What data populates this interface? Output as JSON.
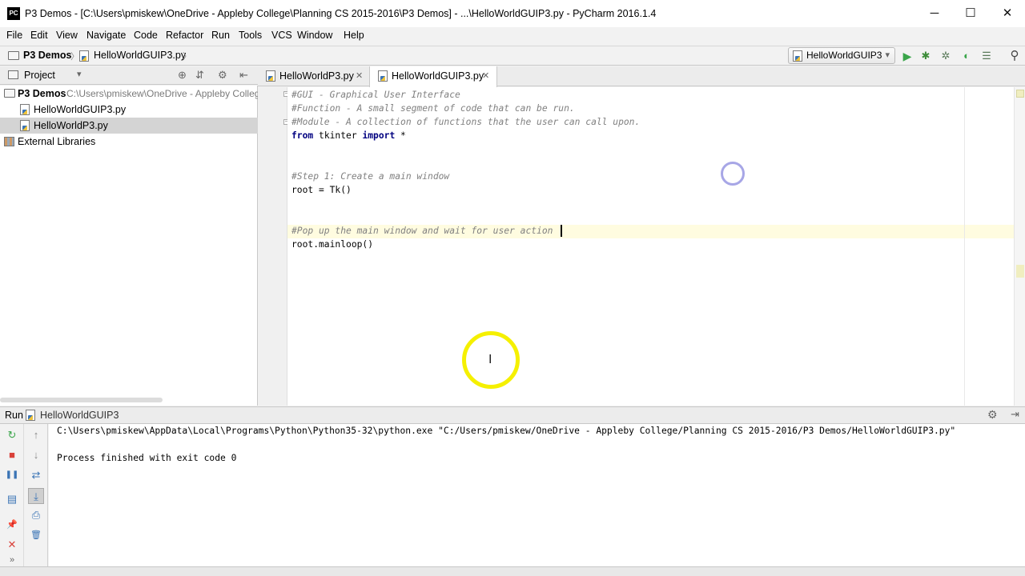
{
  "window": {
    "app_icon": "pycharm-logo",
    "app_icon_text": "PC",
    "title": "P3 Demos - [C:\\Users\\pmiskew\\OneDrive - Appleby College\\Planning CS 2015-2016\\P3 Demos] - ...\\HelloWorldGUIP3.py - PyCharm 2016.1.4",
    "minimize": "─",
    "maximize": "☐",
    "close": "✕"
  },
  "menu": [
    "File",
    "Edit",
    "View",
    "Navigate",
    "Code",
    "Refactor",
    "Run",
    "Tools",
    "VCS",
    "Window",
    "Help"
  ],
  "breadcrumb": {
    "project": "P3 Demos",
    "file": "HelloWorldGUIP3.py",
    "separator": "〉"
  },
  "toolbar": {
    "run_config": "HelloWorldGUIP3",
    "dropdown_icon": "▾",
    "run_icon": "▶",
    "debug_icon": "✱",
    "coverage_icon": "✲",
    "profile_icon": "◐",
    "concurrency_icon": "☰",
    "search_icon": "⚲"
  },
  "project_panel": {
    "label": "Project",
    "dropdown_icon": "▾",
    "tree": [
      {
        "label": "P3 Demos",
        "path": "C:\\Users\\pmiskew\\OneDrive - Appleby College",
        "selected": false
      },
      {
        "label": "HelloWorldGUIP3.py",
        "selected": false
      },
      {
        "label": "HelloWorldP3.py",
        "selected": true
      },
      {
        "label": "External Libraries",
        "selected": false
      }
    ]
  },
  "tabs": [
    {
      "label": "HelloWorldP3.py",
      "active": false,
      "close": "✕"
    },
    {
      "label": "HelloWorldGUIP3.py",
      "active": true,
      "close": "✕"
    }
  ],
  "editor": {
    "lines": [
      {
        "kind": "comment",
        "text": "#GUI - Graphical User Interface"
      },
      {
        "kind": "comment",
        "text": "#Function - A small segment of code that can be run."
      },
      {
        "kind": "comment",
        "text": "#Module - A collection of functions that the user can call upon."
      },
      {
        "kind": "import",
        "kw1": "from",
        "mod": " tkinter ",
        "kw2": "import",
        "rest": " *"
      },
      {
        "kind": "blank",
        "text": ""
      },
      {
        "kind": "blank",
        "text": ""
      },
      {
        "kind": "comment",
        "text": "#Step 1: Create a main window"
      },
      {
        "kind": "code",
        "text": "root = Tk()"
      },
      {
        "kind": "blank",
        "text": ""
      },
      {
        "kind": "blank",
        "text": ""
      },
      {
        "kind": "comment",
        "text": "#Pop up the main window and wait for user action"
      },
      {
        "kind": "code",
        "text": "root.mainloop()"
      }
    ]
  },
  "run_panel": {
    "label": "Run",
    "config": "HelloWorldGUIP3",
    "settings_icon": "⚙",
    "hide_icon": "⇥",
    "console": [
      "C:\\Users\\pmiskew\\AppData\\Local\\Programs\\Python\\Python35-32\\python.exe \"C:/Users/pmiskew/OneDrive - Appleby College/Planning CS 2015-2016/P3 Demos/HelloWorldGUIP3.py\"",
      "",
      "Process finished with exit code 0"
    ],
    "tools": {
      "rerun": "↻",
      "stop": "■",
      "pause": "❚❚",
      "layout": "▤",
      "pin": "📌",
      "close": "✕",
      "more": "»",
      "up": "↑",
      "down": "↓",
      "wrap": "⇄",
      "scroll_end": "⤓",
      "print": "⎙",
      "clear": "🗑"
    }
  },
  "colors": {
    "comment": "#808080",
    "keyword": "#000080",
    "selection": "#d4d4d4",
    "run_green": "#3aa54a",
    "stop_red": "#d9413a",
    "cursor_highlight": "#f5f000",
    "click_ring": "#a7a6e6"
  }
}
